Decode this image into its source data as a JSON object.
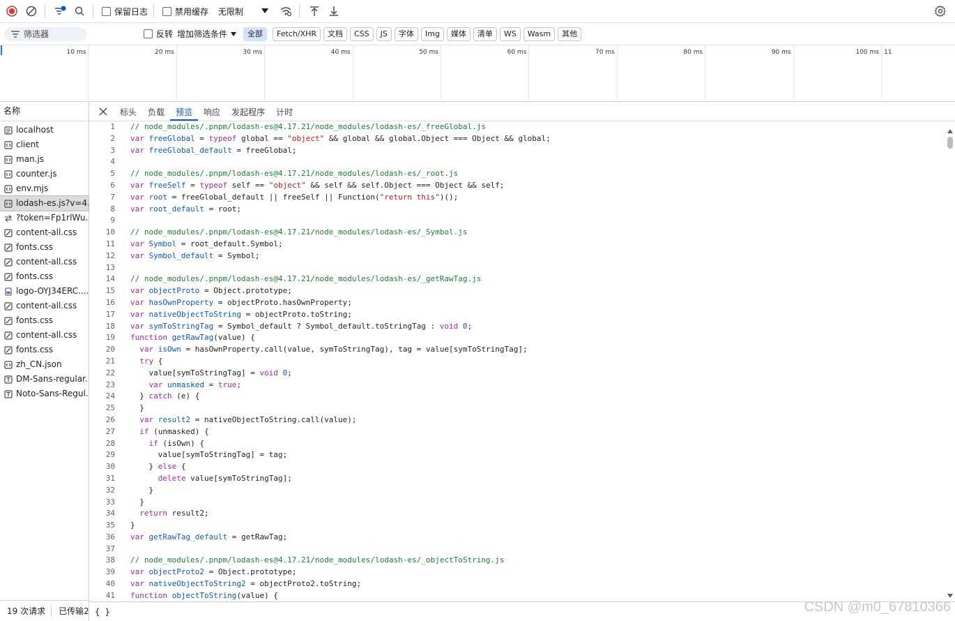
{
  "toolbar": {
    "preserve_log_label": "保留日志",
    "disable_cache_label": "禁用缓存",
    "throttle_label": "无限制"
  },
  "filterbar": {
    "placeholder": "筛选器",
    "invert_label": "反转",
    "more_filters_label": "增加筛选条件",
    "chips": [
      "全部",
      "Fetch/XHR",
      "文档",
      "CSS",
      "JS",
      "字体",
      "Img",
      "媒体",
      "清单",
      "WS",
      "Wasm",
      "其他"
    ]
  },
  "timeline": {
    "ticks": [
      "10 ms",
      "20 ms",
      "30 ms",
      "40 ms",
      "50 ms",
      "60 ms",
      "70 ms",
      "80 ms",
      "90 ms",
      "100 ms",
      "11"
    ]
  },
  "requests": {
    "header": "名称",
    "items": [
      {
        "name": "localhost",
        "icon": "doc-icon"
      },
      {
        "name": "client",
        "icon": "script-icon"
      },
      {
        "name": "man.js",
        "icon": "script-icon"
      },
      {
        "name": "counter.js",
        "icon": "script-icon"
      },
      {
        "name": "env.mjs",
        "icon": "script-icon"
      },
      {
        "name": "lodash-es.js?v=4...",
        "icon": "script-icon",
        "selected": true
      },
      {
        "name": "?token=Fp1rlWu...",
        "icon": "websocket-icon"
      },
      {
        "name": "content-all.css",
        "icon": "css-icon"
      },
      {
        "name": "fonts.css",
        "icon": "css-icon"
      },
      {
        "name": "content-all.css",
        "icon": "css-icon"
      },
      {
        "name": "fonts.css",
        "icon": "css-icon"
      },
      {
        "name": "logo-OYJ34ERC....",
        "icon": "image-icon"
      },
      {
        "name": "content-all.css",
        "icon": "css-icon"
      },
      {
        "name": "fonts.css",
        "icon": "css-icon"
      },
      {
        "name": "content-all.css",
        "icon": "css-icon"
      },
      {
        "name": "fonts.css",
        "icon": "css-icon"
      },
      {
        "name": "zh_CN.json",
        "icon": "script-icon"
      },
      {
        "name": "DM-Sans-regular...",
        "icon": "font-icon"
      },
      {
        "name": "Noto-Sans-Regul...",
        "icon": "font-icon"
      }
    ],
    "footer_count": "19 次请求",
    "footer_transferred": "已传输2."
  },
  "detail": {
    "tabs": [
      "标头",
      "负载",
      "预览",
      "响应",
      "发起程序",
      "计时"
    ],
    "active_tab": 2,
    "code_lines": [
      "// node_modules/.pnpm/lodash-es@4.17.21/node_modules/lodash-es/_freeGlobal.js",
      "var freeGlobal = typeof global == \"object\" && global && global.Object === Object && global;",
      "var freeGlobal_default = freeGlobal;",
      "",
      "// node_modules/.pnpm/lodash-es@4.17.21/node_modules/lodash-es/_root.js",
      "var freeSelf = typeof self == \"object\" && self && self.Object === Object && self;",
      "var root = freeGlobal_default || freeSelf || Function(\"return this\")();",
      "var root_default = root;",
      "",
      "// node_modules/.pnpm/lodash-es@4.17.21/node_modules/lodash-es/_Symbol.js",
      "var Symbol = root_default.Symbol;",
      "var Symbol_default = Symbol;",
      "",
      "// node_modules/.pnpm/lodash-es@4.17.21/node_modules/lodash-es/_getRawTag.js",
      "var objectProto = Object.prototype;",
      "var hasOwnProperty = objectProto.hasOwnProperty;",
      "var nativeObjectToString = objectProto.toString;",
      "var symToStringTag = Symbol_default ? Symbol_default.toStringTag : void 0;",
      "function getRawTag(value) {",
      "  var isOwn = hasOwnProperty.call(value, symToStringTag), tag = value[symToStringTag];",
      "  try {",
      "    value[symToStringTag] = void 0;",
      "    var unmasked = true;",
      "  } catch (e) {",
      "  }",
      "  var result2 = nativeObjectToString.call(value);",
      "  if (unmasked) {",
      "    if (isOwn) {",
      "      value[symToStringTag] = tag;",
      "    } else {",
      "      delete value[symToStringTag];",
      "    }",
      "  }",
      "  return result2;",
      "}",
      "var getRawTag_default = getRawTag;",
      "",
      "// node_modules/.pnpm/lodash-es@4.17.21/node_modules/lodash-es/_objectToString.js",
      "var objectProto2 = Object.prototype;",
      "var nativeObjectToString2 = objectProto2.toString;",
      "function objectToString(value) {"
    ],
    "format_button": "{ }"
  },
  "watermark": "CSDN @m0_67810366",
  "colors": {
    "keyword": "#a626a4",
    "string": "#c41a16",
    "comment": "#1a7f37",
    "identifier": "#0b57d0",
    "accent": "#0b57d0"
  }
}
